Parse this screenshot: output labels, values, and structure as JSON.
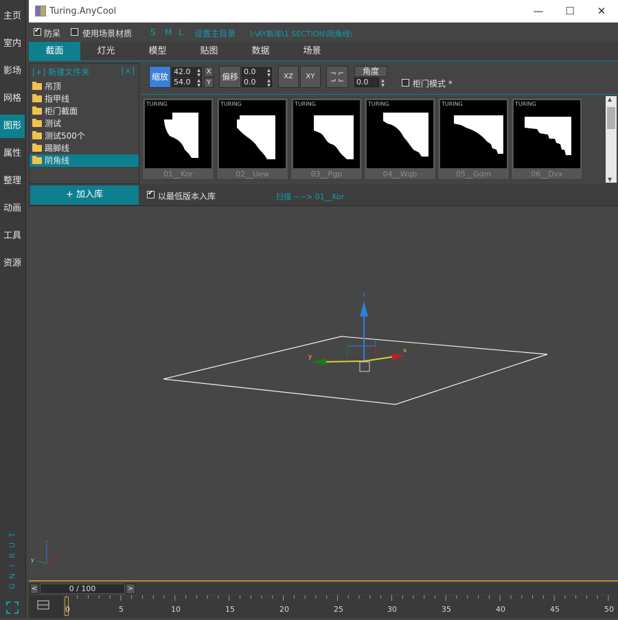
{
  "sidebar": {
    "items": [
      {
        "label": "主页"
      },
      {
        "label": "室内"
      },
      {
        "label": "影场"
      },
      {
        "label": "网格"
      },
      {
        "label": "图形"
      },
      {
        "label": "属性"
      },
      {
        "label": "整理"
      },
      {
        "label": "动画"
      },
      {
        "label": "工具"
      },
      {
        "label": "资源"
      }
    ],
    "active": "图形",
    "brand_vertical": "TURING"
  },
  "window": {
    "title": "Turing.AnyCool",
    "minimize": "—",
    "maximize": "☐",
    "close": "✕"
  },
  "options": {
    "anti_dull": {
      "label": "防呆",
      "checked": true
    },
    "use_scene_material": {
      "label": "使用场景材质",
      "checked": false
    },
    "size_s": "S",
    "size_m": "M",
    "size_l": "L",
    "set_main_dir": "设置主目录",
    "path": "I:\\AY新库\\1.SECTION\\阴角线\\"
  },
  "tabs": [
    {
      "label": "截面"
    },
    {
      "label": "灯光"
    },
    {
      "label": "模型"
    },
    {
      "label": "贴图"
    },
    {
      "label": "数据"
    },
    {
      "label": "场景"
    }
  ],
  "tree": {
    "new_folder": "[+] 新建文件夹",
    "close": "[×]",
    "folders": [
      "吊顶",
      "指甲线",
      "柜门截面",
      "测试",
      "测试500个",
      "踢脚线",
      "阴角线"
    ],
    "selected": "阴角线"
  },
  "controls": {
    "scale_label": "缩放",
    "scale_x": "42.0",
    "scale_y": "54.0",
    "x_label": "X",
    "y_label": "Y",
    "offset_label": "偏移",
    "offset_x": "0.0",
    "offset_y": "0.0",
    "xz_label": "XZ",
    "xy_label": "XY",
    "angle_label": "角度",
    "angle_value": "0.0",
    "cabinet_mode": {
      "label": "柜门模式 *",
      "checked": false
    }
  },
  "gallery": {
    "brand": "TURING",
    "items": [
      {
        "label": "01__Kor"
      },
      {
        "label": "02__Uew"
      },
      {
        "label": "03__Pgp"
      },
      {
        "label": "04__Wqb"
      },
      {
        "label": "05__Gdm"
      },
      {
        "label": "06__Dvx"
      }
    ]
  },
  "addrow": {
    "add_button": "+ 加入库",
    "lowest_version": {
      "label": "以最低版本入库",
      "checked": true
    },
    "scan_status": "扫描 ~~> 01__Kor"
  },
  "viewport": {
    "axis_z": "z",
    "axis_x": "x",
    "axis_y": "y"
  },
  "timeline": {
    "frame_display": "0 / 100",
    "prev": "<",
    "next": ">",
    "ticks": [
      "0",
      "5",
      "10",
      "15",
      "20",
      "25",
      "30",
      "35",
      "40",
      "45",
      "50"
    ]
  },
  "colors": {
    "accent": "#0e7f8f",
    "accent_text": "#139cb0",
    "scale_button": "#3b7fd6",
    "viewport_bg": "#464646"
  }
}
